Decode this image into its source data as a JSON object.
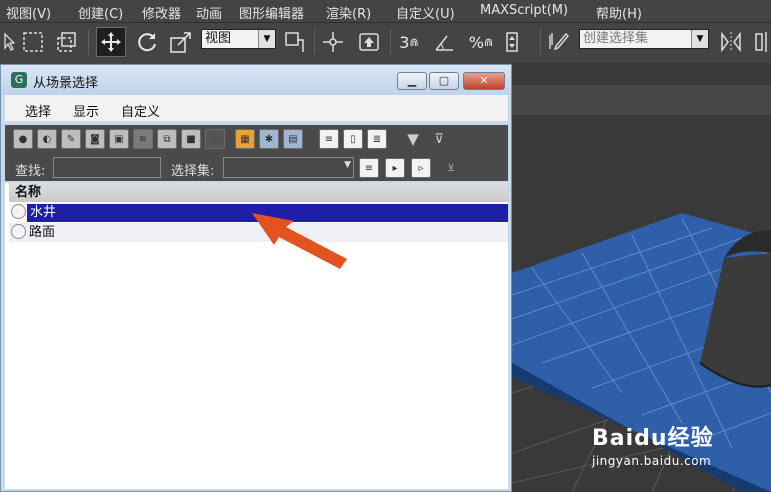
{
  "menubar": {
    "items": [
      "视图(V)",
      "创建(C)",
      "修改器",
      "动画",
      "图形编辑器",
      "渲染(R)",
      "自定义(U)",
      "MAXScript(M)",
      "帮助(H)"
    ]
  },
  "toolbar": {
    "view_combo": "视图",
    "selection_set_combo": "创建选择集",
    "snap_3": "3",
    "snap_percent": "%"
  },
  "dialog": {
    "title": "从场景选择",
    "menu": [
      "选择",
      "显示",
      "自定义"
    ],
    "find_label": "查找:",
    "find_value": "",
    "selection_set_label": "选择集:",
    "selection_set_value": "",
    "column_header": "名称",
    "rows": [
      {
        "name": "水井",
        "selected": true
      },
      {
        "name": "路面",
        "selected": false
      }
    ]
  },
  "watermark": {
    "brand": "Baidu经验",
    "url": "jingyan.baidu.com"
  },
  "colors": {
    "selection": "#1e1ea8",
    "arrow": "#e2531f",
    "plane": "#2e5fa8"
  }
}
